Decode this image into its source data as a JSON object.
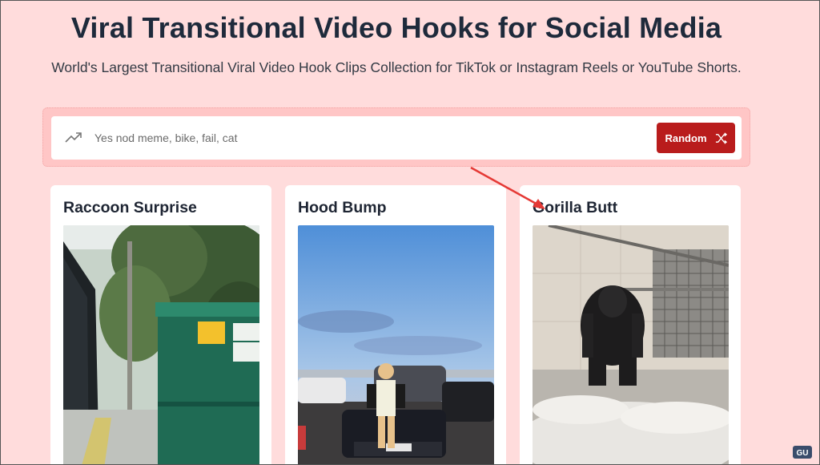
{
  "header": {
    "title": "Viral Transitional Video Hooks for Social Media",
    "subtitle": "World's Largest Transitional Viral Video Hook Clips Collection for TikTok or Instagram Reels or YouTube Shorts."
  },
  "search": {
    "icon": "trending-up-icon",
    "placeholder": "Yes nod meme, bike, fail, cat",
    "value": "",
    "random_label": "Random",
    "random_icon": "shuffle-icon"
  },
  "cards": [
    {
      "title": "Raccoon Surprise"
    },
    {
      "title": "Hood Bump"
    },
    {
      "title": "Gorilla Butt"
    }
  ],
  "annotation": {
    "arrow_color": "#e53935"
  },
  "colors": {
    "background": "#ffdcdc",
    "accent": "#b91c1c",
    "title": "#1e2a3b"
  }
}
